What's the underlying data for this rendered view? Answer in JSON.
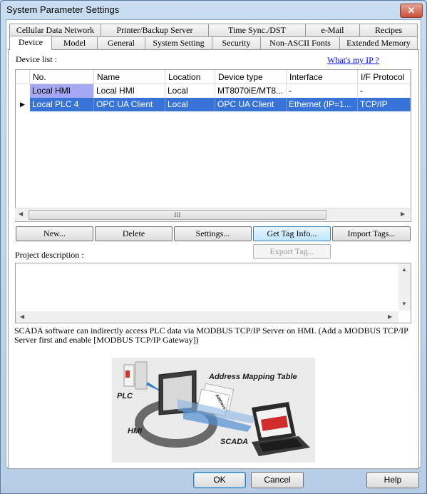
{
  "window": {
    "title": "System Parameter Settings",
    "close_glyph": "✕"
  },
  "tabs_back": [
    "Cellular Data Network",
    "Printer/Backup Server",
    "Time Sync./DST",
    "e-Mail",
    "Recipes"
  ],
  "tabs_front": [
    "Device",
    "Model",
    "General",
    "System Setting",
    "Security",
    "Non-ASCII Fonts",
    "Extended Memory"
  ],
  "device_list_label": "Device list :",
  "whats_my_ip": "What's my IP ?",
  "grid": {
    "columns": [
      "No.",
      "Name",
      "Location",
      "Device type",
      "Interface",
      "I/F Protocol"
    ],
    "rows": [
      [
        "Local HMI",
        "Local HMI",
        "Local",
        "MT8070iE/MT8...",
        "-",
        "-"
      ],
      [
        "Local PLC 4",
        "OPC UA Client",
        "Local",
        "OPC UA Client",
        "Ethernet (IP=1...",
        "TCP/IP"
      ]
    ],
    "row_pointer_glyph": "▶",
    "scroll_left": "◀",
    "scroll_right": "▶",
    "thumb_grip": "III"
  },
  "buttons": {
    "new": "New...",
    "delete": "Delete",
    "settings": "Settings...",
    "get_tag_info": "Get Tag Info...",
    "import_tags": "Import Tags...",
    "export_tag": "Export Tag..."
  },
  "project_description_label": "Project description :",
  "desc_scroll": {
    "up": "▲",
    "down": "▼",
    "left": "◀",
    "right": "▶"
  },
  "note": "SCADA software can indirectly access PLC data via MODBUS TCP/IP Server on HMI. (Add a MODBUS TCP/IP Server first and enable [MODBUS TCP/IP Gateway])",
  "diagram": {
    "address_mapping_table": "Address Mapping Table",
    "plc": "PLC",
    "hmi": "HMI",
    "scada": "SCADA",
    "small_label": "Address"
  },
  "footer": {
    "ok": "OK",
    "cancel": "Cancel",
    "help": "Help"
  },
  "colors": {
    "selected_row": "#3874d8",
    "local_hmi_cell": "#a7a8f4",
    "accent_link": "#0000ee"
  }
}
